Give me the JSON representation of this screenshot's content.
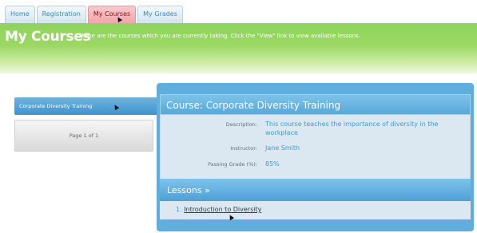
{
  "tabs": [
    {
      "label": "Home"
    },
    {
      "label": "Registration"
    },
    {
      "label": "My Courses",
      "active": true
    },
    {
      "label": "My Grades"
    }
  ],
  "header": {
    "title": "My Courses",
    "description": "These are the courses which you are currently taking. Click the \"View\" link to view available lessons."
  },
  "sidebar": {
    "selected_course": "Corporate Diversity Training",
    "pager": "Page 1 of 1"
  },
  "course": {
    "title": "Course: Corporate Diversity Training",
    "description_label": "Description:",
    "description": "This course teaches the importance of diversity in the workplace",
    "instructor_label": "Instructor:",
    "instructor": "Jane Smith",
    "passing_grade_label": "Passing Grade (%):",
    "passing_grade": "85%"
  },
  "lessons": {
    "heading": "Lessons »",
    "items": [
      {
        "number": "1.",
        "title": "Introduction to Diversity"
      }
    ]
  },
  "colors": {
    "header_green": "#9bd865",
    "panel_blue": "#5faedd",
    "active_tab": "#f1a5aa"
  }
}
